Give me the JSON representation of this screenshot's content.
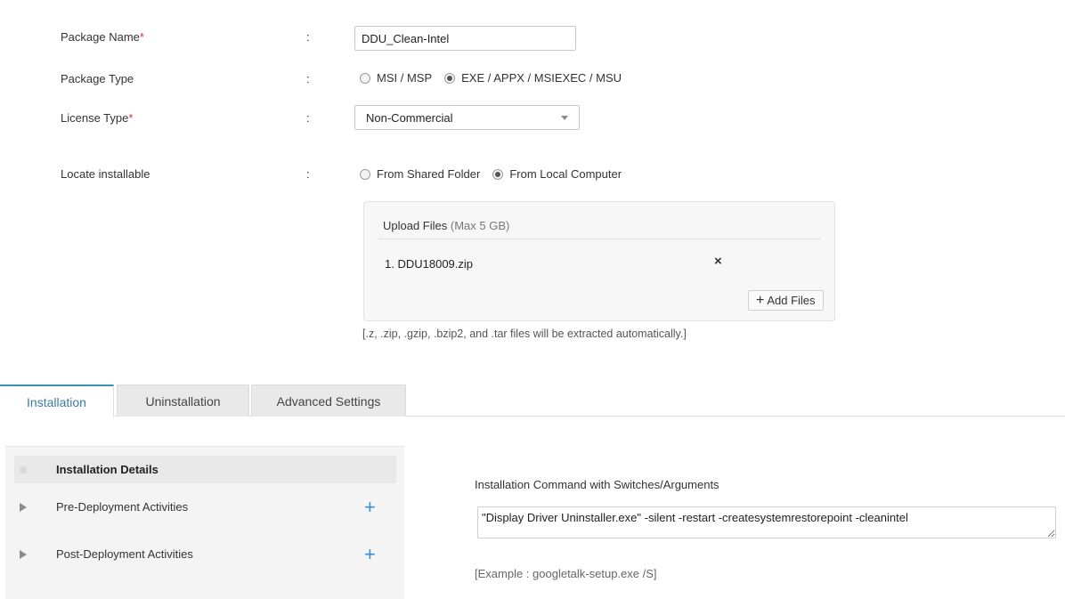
{
  "form": {
    "package_name": {
      "label": "Package Name",
      "required": "*",
      "colon": ":",
      "value": "DDU_Clean-Intel"
    },
    "package_type": {
      "label": "Package Type",
      "colon": ":",
      "options": [
        {
          "label": "MSI / MSP",
          "checked": false
        },
        {
          "label": "EXE / APPX / MSIEXEC / MSU",
          "checked": true
        }
      ]
    },
    "license_type": {
      "label": "License Type",
      "required": "*",
      "colon": ":",
      "value": "Non-Commercial"
    },
    "locate_installable": {
      "label": "Locate installable",
      "colon": ":",
      "options": [
        {
          "label": "From Shared Folder",
          "checked": false
        },
        {
          "label": "From Local Computer",
          "checked": true
        }
      ]
    }
  },
  "upload": {
    "title": "Upload Files",
    "limit": "(Max 5 GB)",
    "files": [
      {
        "index": "1.",
        "name": "DDU18009.zip"
      }
    ],
    "remove_icon": "×",
    "add_label": "Add Files",
    "add_icon": "+",
    "note": "[.z, .zip, .gzip, .bzip2, and .tar files will be extracted automatically.]"
  },
  "tabs": [
    {
      "label": "Installation",
      "active": true
    },
    {
      "label": "Uninstallation",
      "active": false
    },
    {
      "label": "Advanced Settings",
      "active": false
    }
  ],
  "sections": [
    {
      "label": "Installation Details",
      "active": true
    },
    {
      "label": "Pre-Deployment Activities",
      "active": false,
      "action": "+"
    },
    {
      "label": "Post-Deployment Activities",
      "active": false,
      "action": "+"
    }
  ],
  "install": {
    "command_label": "Installation Command with Switches/Arguments",
    "command_value": "\"Display Driver Uninstaller.exe\" -silent -restart -createsystemrestorepoint -cleanintel",
    "example": "[Example : googletalk-setup.exe /S]"
  },
  "colors": {
    "accent": "#3a8fd5",
    "tab_active": "#3a7ca5",
    "required": "#e03030"
  }
}
